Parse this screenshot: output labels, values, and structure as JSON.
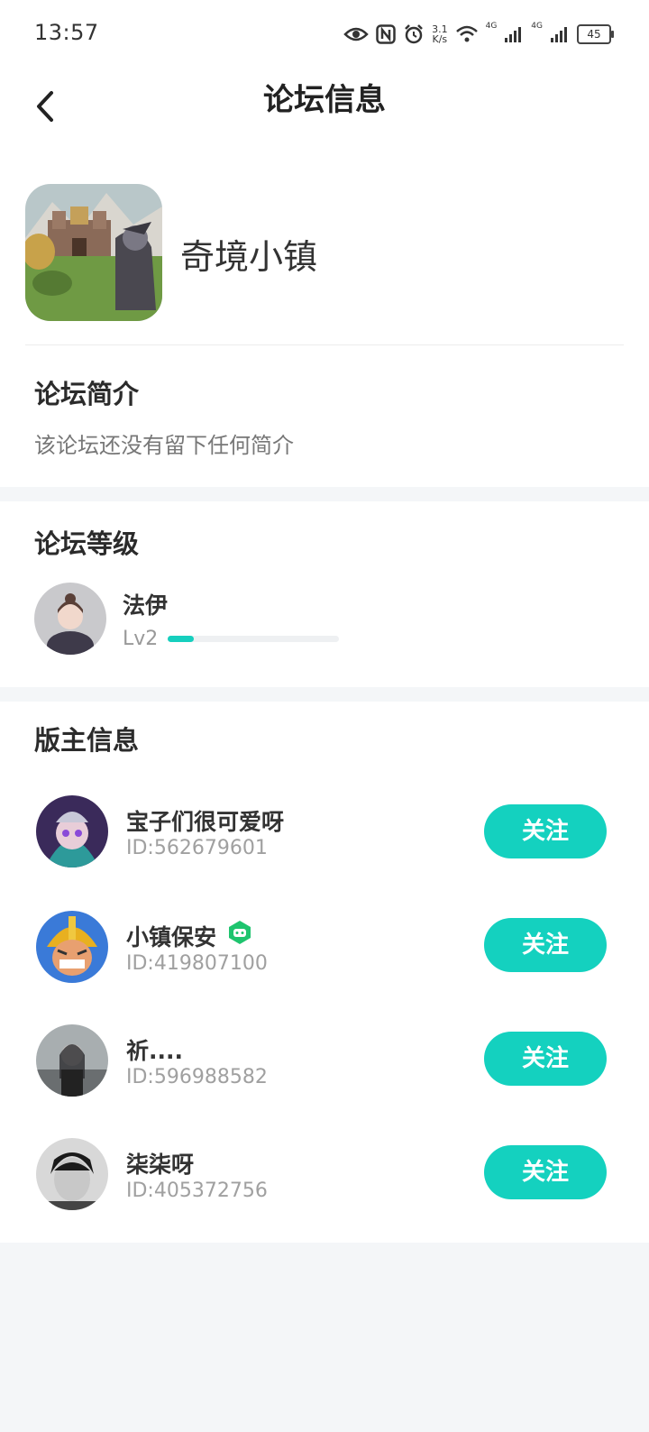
{
  "status": {
    "time": "13:57",
    "speed_top": "3.1",
    "speed_bottom": "K/s",
    "battery": "45",
    "net1": "4G",
    "net2": "4G"
  },
  "nav": {
    "title": "论坛信息"
  },
  "forum": {
    "name": "奇境小镇"
  },
  "intro": {
    "heading": "论坛简介",
    "text": "该论坛还没有留下任何简介"
  },
  "level": {
    "heading": "论坛等级",
    "user": "法伊",
    "lv": "Lv2",
    "progress": 0.15
  },
  "moderators": {
    "heading": "版主信息",
    "follow_label": "关注",
    "items": [
      {
        "name": "宝子们很可爱呀",
        "id": "ID:562679601"
      },
      {
        "name": "小镇保安",
        "id": "ID:419807100"
      },
      {
        "name": "祈....",
        "id": "ID:596988582"
      },
      {
        "name": "柒柒呀",
        "id": "ID:405372756"
      }
    ]
  },
  "colors": {
    "accent": "#14d1bf",
    "bg": "#f4f6f8",
    "badge": "#1ec46e"
  }
}
